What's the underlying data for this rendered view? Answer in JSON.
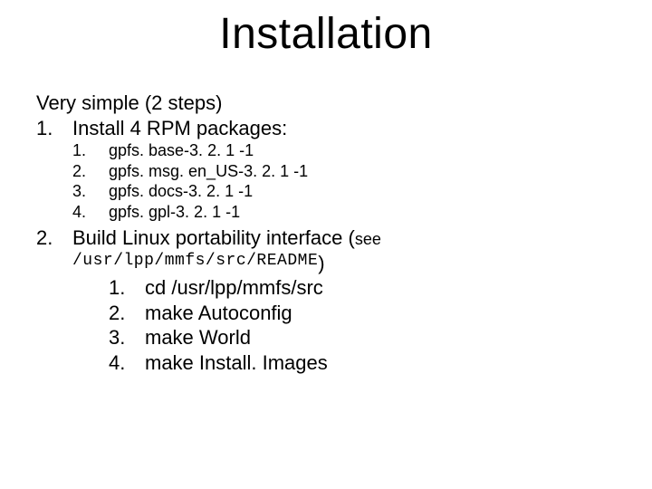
{
  "title": "Installation",
  "intro": "Very simple (2 steps)",
  "step1": {
    "marker": "1.",
    "label": "Install 4 RPM packages:",
    "items": [
      {
        "marker": "1.",
        "text": "gpfs. base-3. 2. 1 -1"
      },
      {
        "marker": "2.",
        "text": "gpfs. msg. en_US-3. 2. 1 -1"
      },
      {
        "marker": "3.",
        "text": "gpfs. docs-3. 2. 1 -1"
      },
      {
        "marker": "4.",
        "text": "gpfs. gpl-3. 2. 1 -1"
      }
    ]
  },
  "step2": {
    "marker": "2.",
    "label_main": "Build Linux portability interface (",
    "label_see": "see",
    "readme_path": "/usr/lpp/mmfs/src/README",
    "close_paren": ")",
    "items": [
      {
        "marker": "1.",
        "text": "cd /usr/lpp/mmfs/src"
      },
      {
        "marker": "2.",
        "text": "make Autoconfig"
      },
      {
        "marker": "3.",
        "text": "make World"
      },
      {
        "marker": "4.",
        "text": "make Install. Images"
      }
    ]
  }
}
